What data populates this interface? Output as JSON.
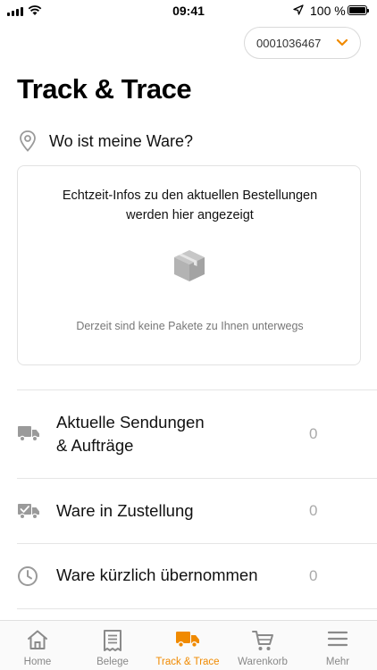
{
  "status_bar": {
    "time": "09:41",
    "battery": "100 %"
  },
  "account": {
    "number": "0001036467"
  },
  "page": {
    "title": "Track & Trace"
  },
  "where": {
    "label": "Wo ist meine Ware?"
  },
  "info_card": {
    "headline_line1": "Echtzeit-Infos zu den aktuellen Bestellungen",
    "headline_line2": "werden hier angezeigt",
    "empty_text": "Derzeit sind keine Pakete zu Ihnen unterwegs",
    "icon": "package-icon"
  },
  "rows": [
    {
      "line1": "Aktuelle Sendungen",
      "line2": "& Aufträge",
      "count": "0",
      "icon": "truck-icon"
    },
    {
      "line1": "Ware in Zustellung",
      "count": "0",
      "icon": "truck-check-icon"
    },
    {
      "line1": "Ware kürzlich übernommen",
      "count": "0",
      "icon": "clock-icon"
    }
  ],
  "tabs": [
    {
      "label": "Home",
      "icon": "home-icon"
    },
    {
      "label": "Belege",
      "icon": "receipt-icon"
    },
    {
      "label": "Track & Trace",
      "icon": "truck-icon",
      "active": true
    },
    {
      "label": "Warenkorb",
      "icon": "cart-icon"
    },
    {
      "label": "Mehr",
      "icon": "menu-icon"
    }
  ],
  "colors": {
    "accent": "#f08a00",
    "icon_gray": "#9a9a9a",
    "divider": "#e5e5e5"
  }
}
